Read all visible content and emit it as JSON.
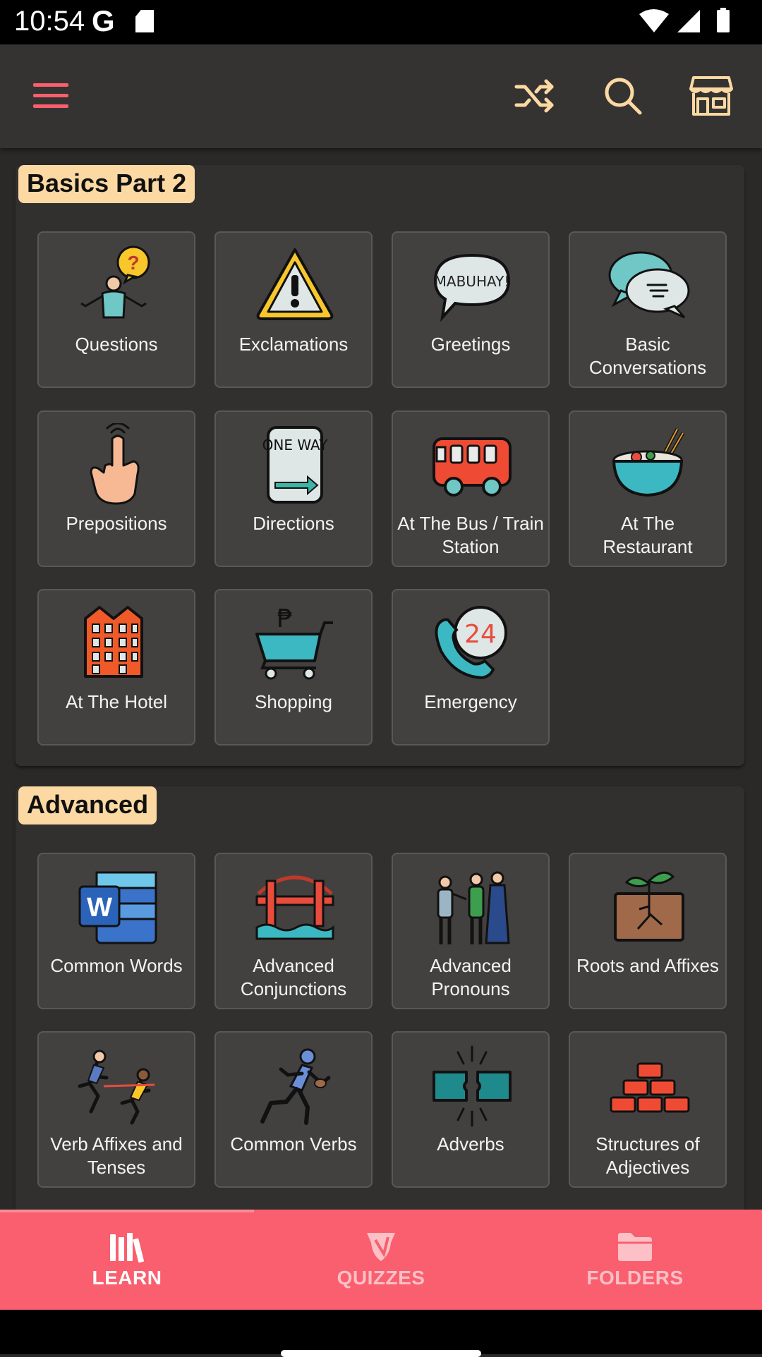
{
  "status_bar": {
    "time": "10:54",
    "g_icon": "G",
    "icons": [
      "google-icon",
      "sd-card-icon",
      "wifi-icon",
      "signal-icon",
      "battery-icon"
    ]
  },
  "toolbar": {
    "icons": [
      "menu-icon",
      "shuffle-icon",
      "search-icon",
      "store-icon"
    ],
    "accent_color": "#f95f6e",
    "icon_color": "#fcd9a2"
  },
  "sections": [
    {
      "title": "Basics Part 2",
      "tiles": [
        {
          "label": "Questions",
          "icon": "question-person-icon"
        },
        {
          "label": "Exclamations",
          "icon": "warning-icon"
        },
        {
          "label": "Greetings",
          "icon": "speech-bubble-mabuhay-icon",
          "icon_text": "MABUHAY!"
        },
        {
          "label": "Basic Conversations",
          "icon": "chat-bubbles-icon"
        },
        {
          "label": "Prepositions",
          "icon": "pointing-hand-icon"
        },
        {
          "label": "Directions",
          "icon": "one-way-sign-icon",
          "icon_text": "ONE WAY"
        },
        {
          "label": "At The Bus / Train Station",
          "icon": "bus-icon"
        },
        {
          "label": "At The Restaurant",
          "icon": "noodle-bowl-icon"
        },
        {
          "label": "At The Hotel",
          "icon": "hotel-building-icon"
        },
        {
          "label": "Shopping",
          "icon": "shopping-cart-icon",
          "icon_text": "₱"
        },
        {
          "label": "Emergency",
          "icon": "emergency-phone-icon",
          "icon_text": "24"
        }
      ]
    },
    {
      "title": "Advanced",
      "tiles": [
        {
          "label": "Common Words",
          "icon": "word-document-icon",
          "icon_text": "W"
        },
        {
          "label": "Advanced Conjunctions",
          "icon": "bridge-icon"
        },
        {
          "label": "Advanced Pronouns",
          "icon": "people-group-icon"
        },
        {
          "label": "Roots and Affixes",
          "icon": "plant-roots-icon"
        },
        {
          "label": "Verb Affixes and Tenses",
          "icon": "runners-icon"
        },
        {
          "label": "Common Verbs",
          "icon": "runner-icon"
        },
        {
          "label": "Adverbs",
          "icon": "connecting-blocks-icon"
        },
        {
          "label": "Structures of Adjectives",
          "icon": "bricks-icon"
        }
      ]
    }
  ],
  "bottom_nav": {
    "items": [
      {
        "label": "LEARN",
        "icon": "library-icon",
        "active": true
      },
      {
        "label": "QUIZZES",
        "icon": "quiz-icon",
        "active": false
      },
      {
        "label": "FOLDERS",
        "icon": "folder-icon",
        "active": false
      }
    ],
    "background_color": "#f95f6e"
  }
}
